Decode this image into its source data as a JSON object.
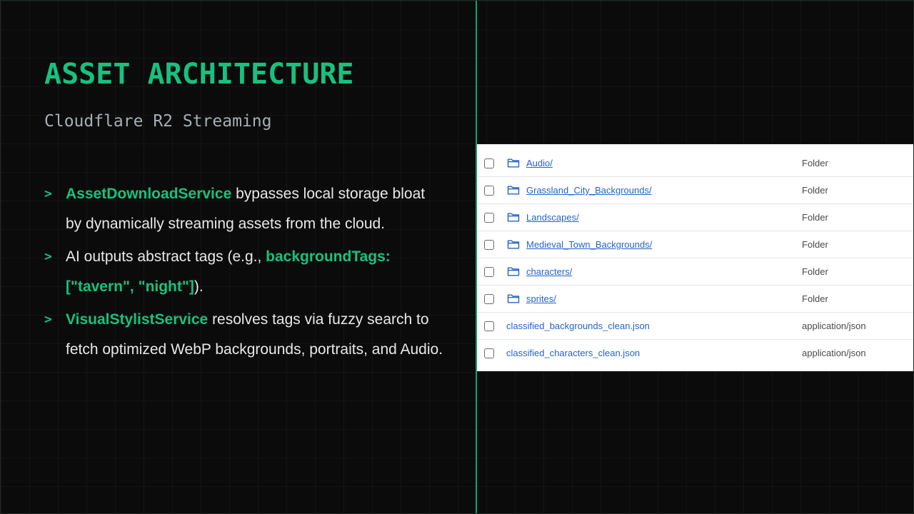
{
  "slide": {
    "title": "ASSET ARCHITECTURE",
    "subtitle": "Cloudflare R2 Streaming",
    "bullets": [
      {
        "marker": ">",
        "highlight": "AssetDownloadService",
        "text": " bypasses local storage bloat by dynamically streaming assets from the cloud."
      },
      {
        "marker": ">",
        "pre": "AI outputs abstract tags (e.g., ",
        "highlight": "backgroundTags: [\"tavern\", \"night\"]",
        "post": ")."
      },
      {
        "marker": ">",
        "highlight": "VisualStylistService",
        "text": " resolves tags via fuzzy search to fetch optimized WebP backgrounds, portraits, and Audio."
      }
    ]
  },
  "file_browser": {
    "rows": [
      {
        "name": "Audio/",
        "type": "Folder",
        "icon": "folder-icon"
      },
      {
        "name": "Grassland_City_Backgrounds/",
        "type": "Folder",
        "icon": "folder-icon"
      },
      {
        "name": "Landscapes/",
        "type": "Folder",
        "icon": "folder-icon"
      },
      {
        "name": "Medieval_Town_Backgrounds/",
        "type": "Folder",
        "icon": "folder-icon"
      },
      {
        "name": "characters/",
        "type": "Folder",
        "icon": "folder-icon"
      },
      {
        "name": "sprites/",
        "type": "Folder",
        "icon": "folder-icon"
      },
      {
        "name": "classified_backgrounds_clean.json",
        "type": "application/json",
        "icon": ""
      },
      {
        "name": "classified_characters_clean.json",
        "type": "application/json",
        "icon": ""
      }
    ]
  },
  "colors": {
    "accent": "#17c17f",
    "background": "#0b0b0b",
    "link": "#2563c9"
  }
}
